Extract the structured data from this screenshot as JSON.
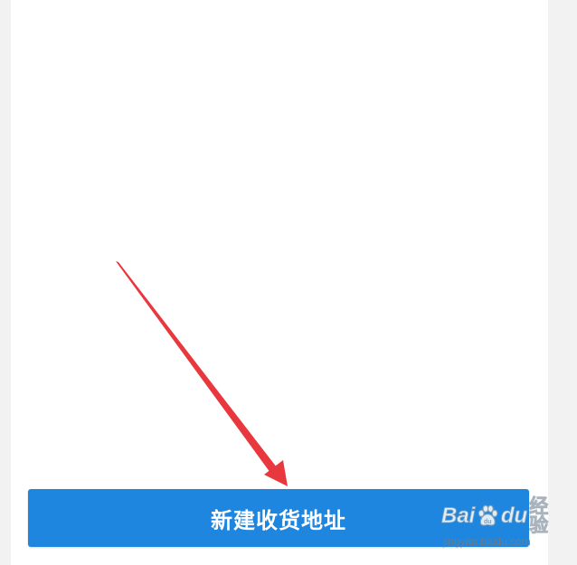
{
  "bottom_bar": {
    "new_address_label": "新建收货地址"
  },
  "colors": {
    "button_blue": "#1e86de",
    "arrow_red": "#e8383d",
    "page_bg": "#ffffff",
    "gutter_bg": "#f2f2f2"
  },
  "watermark": {
    "brand_left": "Bai",
    "brand_right": "du",
    "brand_suffix": "经验",
    "url": "jingyan.baidu.com"
  }
}
